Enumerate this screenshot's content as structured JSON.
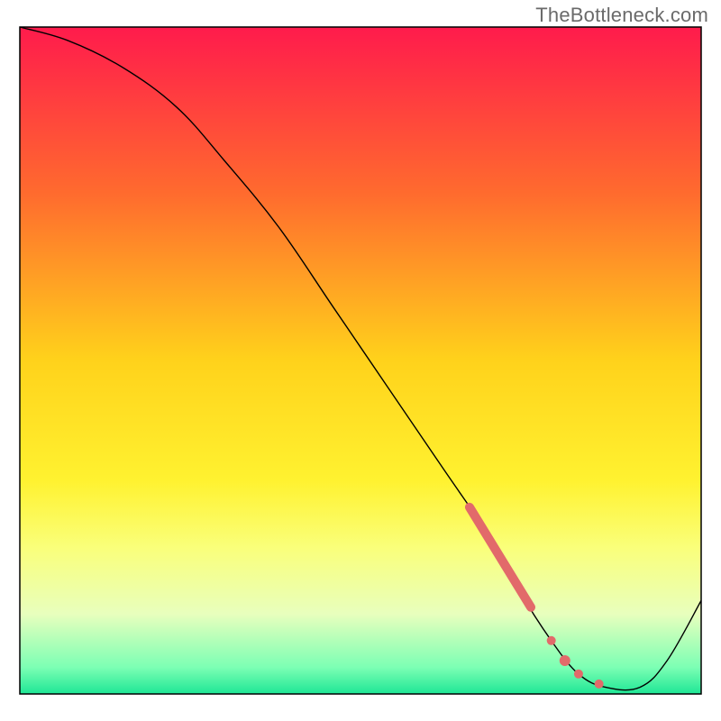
{
  "watermark": "TheBottleneck.com",
  "chart_data": {
    "type": "line",
    "title": "",
    "xlabel": "",
    "ylabel": "",
    "xlim": [
      0,
      100
    ],
    "ylim": [
      0,
      100
    ],
    "background": {
      "type": "vertical-gradient",
      "stops": [
        {
          "pos": 0.0,
          "color": "#ff1b4c"
        },
        {
          "pos": 0.25,
          "color": "#ff6b2e"
        },
        {
          "pos": 0.5,
          "color": "#ffd21b"
        },
        {
          "pos": 0.68,
          "color": "#fff230"
        },
        {
          "pos": 0.78,
          "color": "#faff7a"
        },
        {
          "pos": 0.88,
          "color": "#e8ffbd"
        },
        {
          "pos": 0.96,
          "color": "#7cffb4"
        },
        {
          "pos": 1.0,
          "color": "#1ee695"
        }
      ]
    },
    "series": [
      {
        "name": "bottleneck-curve",
        "color": "#000000",
        "width": 1.2,
        "points": [
          {
            "x": 0,
            "y": 100
          },
          {
            "x": 7,
            "y": 98
          },
          {
            "x": 15,
            "y": 94
          },
          {
            "x": 23,
            "y": 88
          },
          {
            "x": 30,
            "y": 80
          },
          {
            "x": 38,
            "y": 70
          },
          {
            "x": 46,
            "y": 58
          },
          {
            "x": 54,
            "y": 46
          },
          {
            "x": 62,
            "y": 34
          },
          {
            "x": 70,
            "y": 22
          },
          {
            "x": 73,
            "y": 16
          },
          {
            "x": 78,
            "y": 8
          },
          {
            "x": 82,
            "y": 3
          },
          {
            "x": 86,
            "y": 1
          },
          {
            "x": 91,
            "y": 1
          },
          {
            "x": 95,
            "y": 5
          },
          {
            "x": 100,
            "y": 14
          }
        ]
      },
      {
        "name": "highlight-segment",
        "color": "#e26a6a",
        "width": 10,
        "cap": "round",
        "points": [
          {
            "x": 66,
            "y": 28
          },
          {
            "x": 75,
            "y": 13
          }
        ]
      }
    ],
    "markers": [
      {
        "x": 78,
        "y": 8,
        "r": 5,
        "color": "#e26a6a"
      },
      {
        "x": 80,
        "y": 5,
        "r": 6,
        "color": "#e26a6a"
      },
      {
        "x": 82,
        "y": 3,
        "r": 5,
        "color": "#e26a6a"
      },
      {
        "x": 85,
        "y": 1.5,
        "r": 5,
        "color": "#e26a6a"
      }
    ]
  }
}
